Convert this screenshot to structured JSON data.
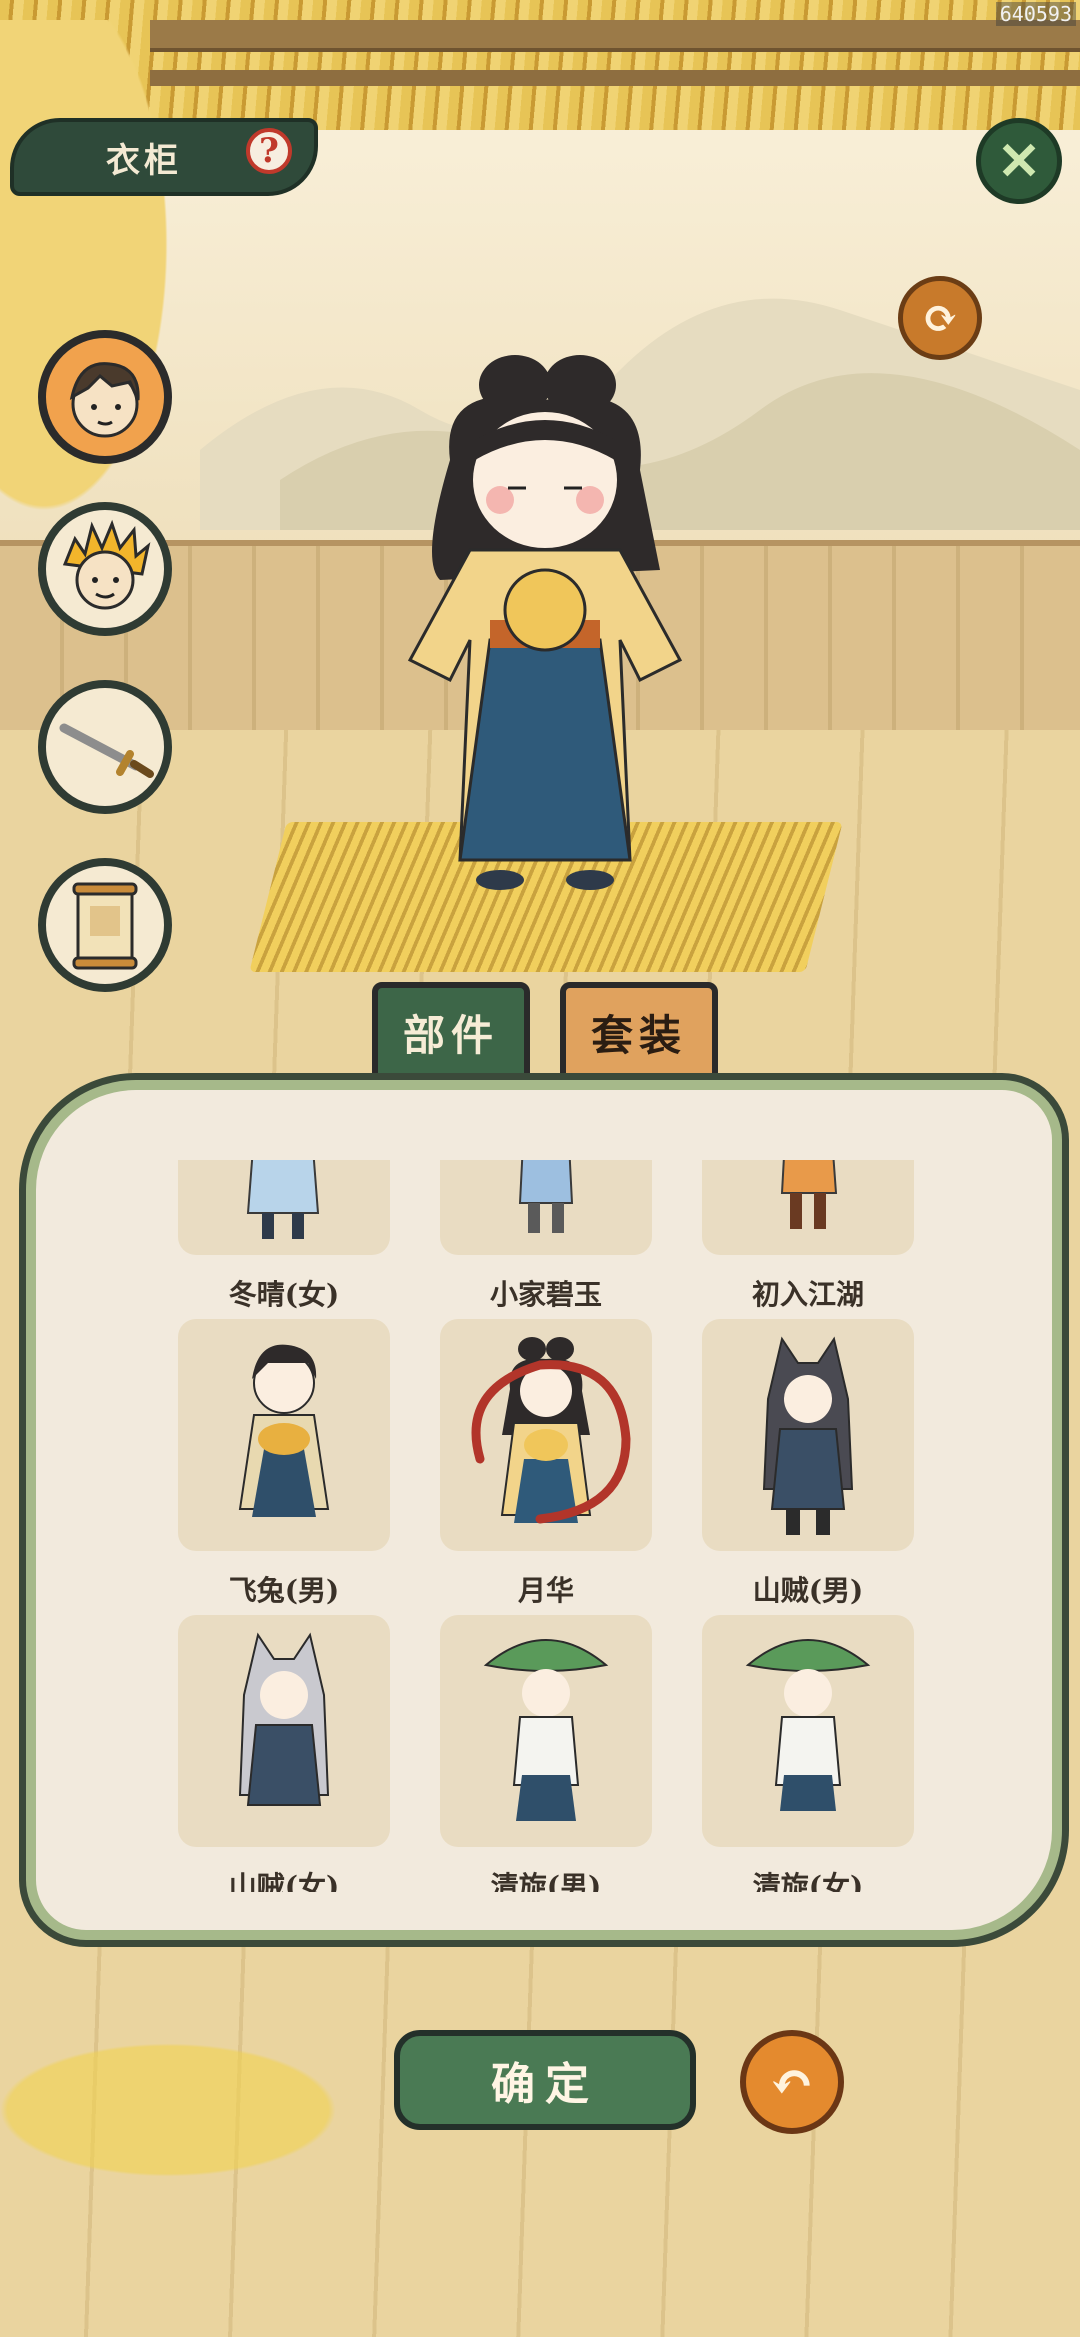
{
  "header": {
    "title": "衣柜",
    "help_icon": "question-icon",
    "close_icon": "close-icon",
    "rotate_icon": "rotate-icon",
    "id_text": "640593"
  },
  "side_menu": [
    {
      "name": "character-avatar",
      "icon": "boy-face-icon",
      "active": true
    },
    {
      "name": "hair-avatar",
      "icon": "golden-hair-face-icon",
      "active": false
    },
    {
      "name": "weapon",
      "icon": "sword-icon",
      "active": false
    },
    {
      "name": "scroll",
      "icon": "scroll-icon",
      "active": false
    }
  ],
  "tabs": [
    {
      "label": "部件",
      "selected": true
    },
    {
      "label": "套装",
      "selected": false
    }
  ],
  "outfits": [
    {
      "label": "冬晴(女)",
      "selected": false
    },
    {
      "label": "小家碧玉",
      "selected": false
    },
    {
      "label": "初入江湖",
      "selected": false
    },
    {
      "label": "飞兔(男)",
      "selected": false
    },
    {
      "label": "月华",
      "selected": true
    },
    {
      "label": "山贼(男)",
      "selected": false
    },
    {
      "label": "山贼(女)",
      "selected": false
    },
    {
      "label": "清旋(男)",
      "selected": false
    },
    {
      "label": "清旋(女)",
      "selected": false
    }
  ],
  "footer": {
    "confirm_label": "确定",
    "back_icon": "undo-icon"
  },
  "colors": {
    "panel_border": "#a6b98a",
    "tab_active": "#3d6648",
    "tab_inactive": "#e0a25e",
    "confirm": "#4a7a54",
    "accent_orange": "#e48a2e",
    "selection_ring": "#b2352a"
  }
}
